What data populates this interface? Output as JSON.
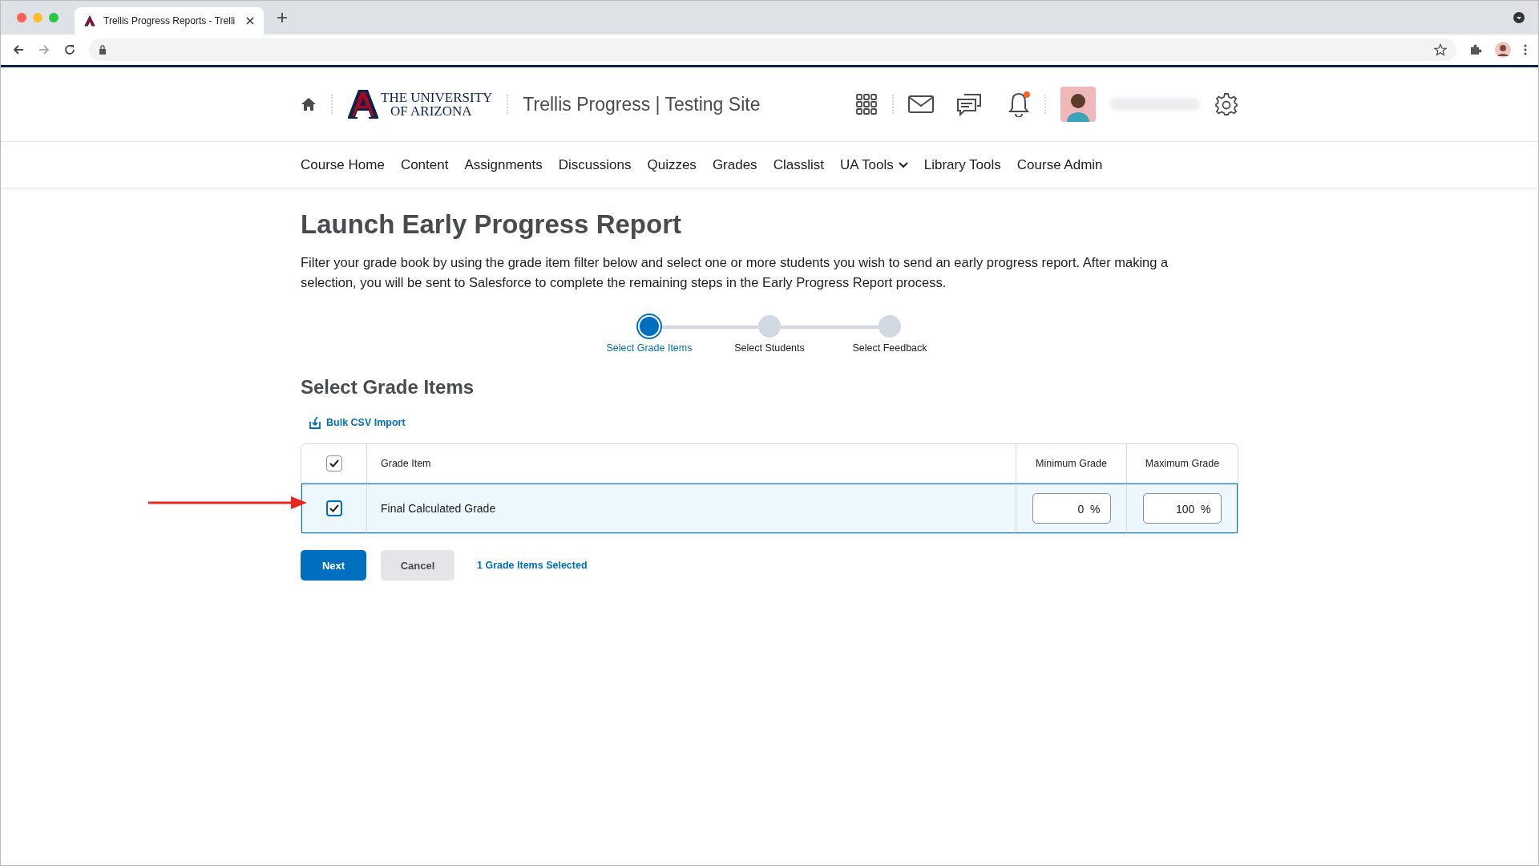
{
  "browser": {
    "tab_title": "Trellis Progress Reports - Trelli"
  },
  "header": {
    "logo_line_1": "THE UNIVERSITY",
    "logo_line_2": "OF ARIZONA",
    "site_title": "Trellis Progress | Testing Site",
    "has_notification": true
  },
  "nav": [
    {
      "label": "Course Home",
      "kind": "link"
    },
    {
      "label": "Content",
      "kind": "link"
    },
    {
      "label": "Assignments",
      "kind": "link"
    },
    {
      "label": "Discussions",
      "kind": "link"
    },
    {
      "label": "Quizzes",
      "kind": "link"
    },
    {
      "label": "Grades",
      "kind": "link"
    },
    {
      "label": "Classlist",
      "kind": "link"
    },
    {
      "label": "UA Tools",
      "kind": "menu"
    },
    {
      "label": "Library Tools",
      "kind": "link"
    },
    {
      "label": "Course Admin",
      "kind": "link"
    }
  ],
  "page": {
    "title": "Launch Early Progress Report",
    "description": "Filter your grade book by using the grade item filter below and select one or more students you wish to send an early progress report. After making a selection, you will be sent to Salesforce to complete the remaining steps in the Early Progress Report process."
  },
  "steps": [
    {
      "label": "Select Grade Items",
      "selected": true
    },
    {
      "label": "Select Students",
      "selected": false
    },
    {
      "label": "Select Feedback",
      "selected": false
    }
  ],
  "section": {
    "title": "Select Grade Items",
    "import_link": "Bulk CSV Import"
  },
  "table": {
    "header_checked": true,
    "columns": [
      "Grade Item",
      "Minimum Grade",
      "Maximum Grade"
    ],
    "rows": [
      {
        "name": "Final Calculated Grade",
        "checked": true,
        "min": "0",
        "max": "100",
        "unit": "%"
      }
    ]
  },
  "buttons": [
    {
      "label": "Next",
      "kind": "primary"
    },
    {
      "label": "Cancel",
      "kind": "secondary"
    }
  ],
  "selection_count": "1 Grade Items Selected"
}
